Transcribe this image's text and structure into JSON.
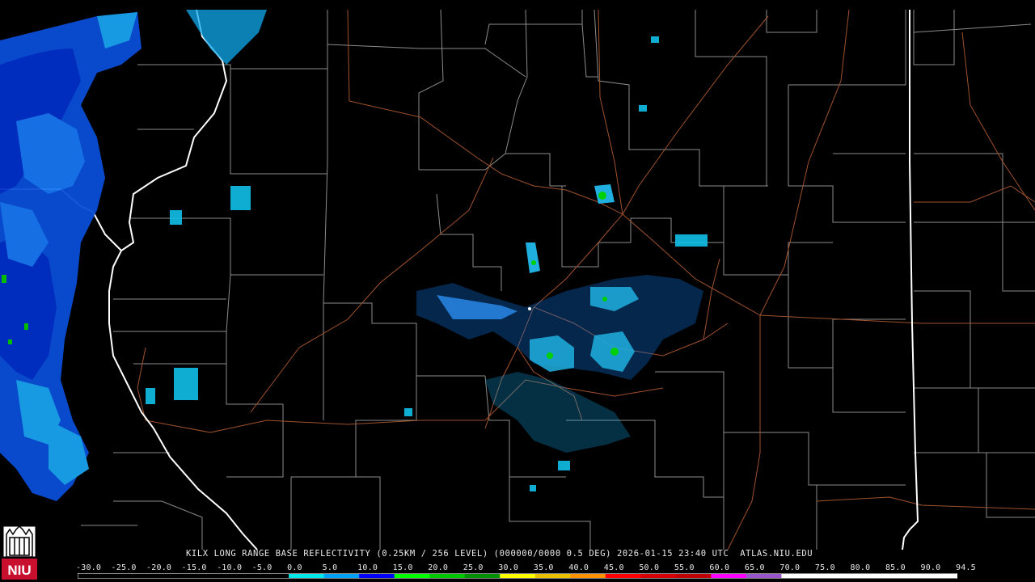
{
  "product": {
    "caption": "KILX LONG RANGE BASE REFLECTIVITY (0.25KM / 256 LEVEL) (000000/0000 0.5 DEG) 2026-01-15 23:40 UTC  ATLAS.NIU.EDU"
  },
  "logo": {
    "text": "NIU"
  },
  "legend": {
    "labels": [
      "-30.0",
      "-25.0",
      "-20.0",
      "-15.0",
      "-10.0",
      "-5.0",
      "0.0",
      "5.0",
      "10.0",
      "15.0",
      "20.0",
      "25.0",
      "30.0",
      "35.0",
      "40.0",
      "45.0",
      "50.0",
      "55.0",
      "60.0",
      "65.0",
      "70.0",
      "75.0",
      "80.0",
      "85.0",
      "90.0",
      "94.5"
    ],
    "colors": [
      "#000000",
      "#000000",
      "#000000",
      "#000000",
      "#000000",
      "#000000",
      "#00e8e8",
      "#00a0f4",
      "#0000f8",
      "#00ff00",
      "#00c800",
      "#009000",
      "#ffff00",
      "#e7c000",
      "#ff9000",
      "#ff0000",
      "#d60000",
      "#c00000",
      "#ff00ff",
      "#9955c9",
      "#ffffff",
      "#ffffff",
      "#ffffff",
      "#ffffff",
      "#ffffff"
    ]
  },
  "colors": {
    "state_border": "#ffffff",
    "county_border": "#9a9a9a",
    "roads": "#a0522d",
    "background": "#000000"
  }
}
